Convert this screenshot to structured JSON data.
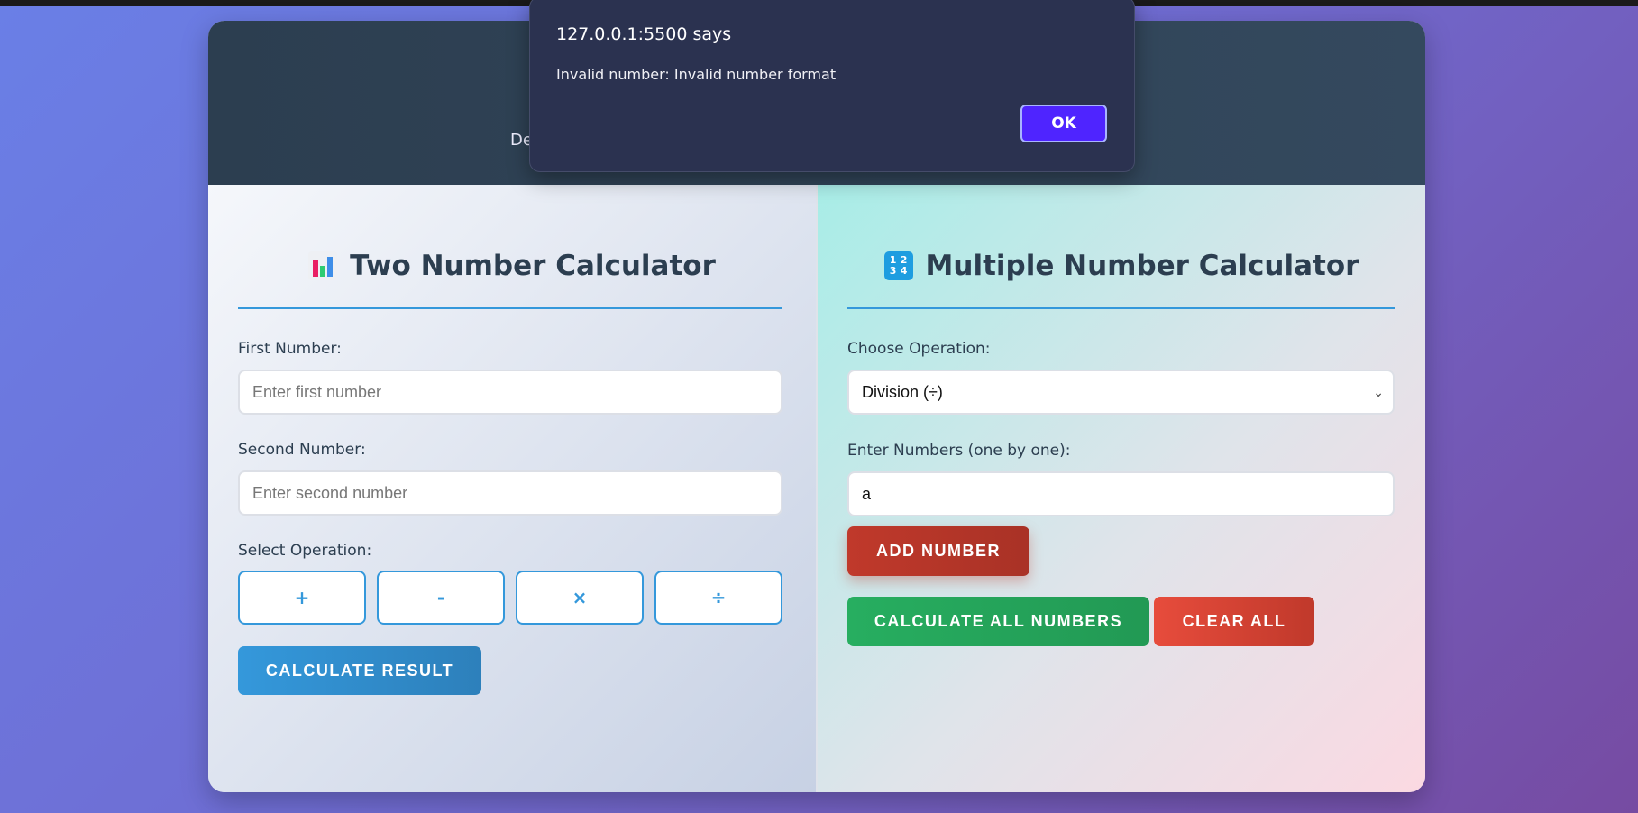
{
  "header": {
    "subtitle_visible": "De"
  },
  "left_panel": {
    "title": "Two Number Calculator",
    "icon": "bar-chart-icon",
    "first_label": "First Number:",
    "first_placeholder": "Enter first number",
    "second_label": "Second Number:",
    "second_placeholder": "Enter second number",
    "operation_label": "Select Operation:",
    "operations": [
      "+",
      "-",
      "×",
      "÷"
    ],
    "calculate_label": "CALCULATE RESULT"
  },
  "right_panel": {
    "title": "Multiple Number Calculator",
    "icon": "input-numbers-icon",
    "icon_digits": [
      "1",
      "2",
      "3",
      "4"
    ],
    "operation_label": "Choose Operation:",
    "operation_selected": "Division (÷)",
    "numbers_label": "Enter Numbers (one by one):",
    "numbers_value": "a",
    "add_label": "ADD NUMBER",
    "calculate_all_label": "CALCULATE ALL NUMBERS",
    "clear_label": "CLEAR ALL"
  },
  "dialog": {
    "title": "127.0.0.1:5500 says",
    "message": "Invalid number: Invalid number format",
    "ok_label": "OK"
  },
  "colors": {
    "accent_blue": "#3498db",
    "red": "#c0392b",
    "green": "#27ae60",
    "dialog_button": "#4f24ff"
  }
}
